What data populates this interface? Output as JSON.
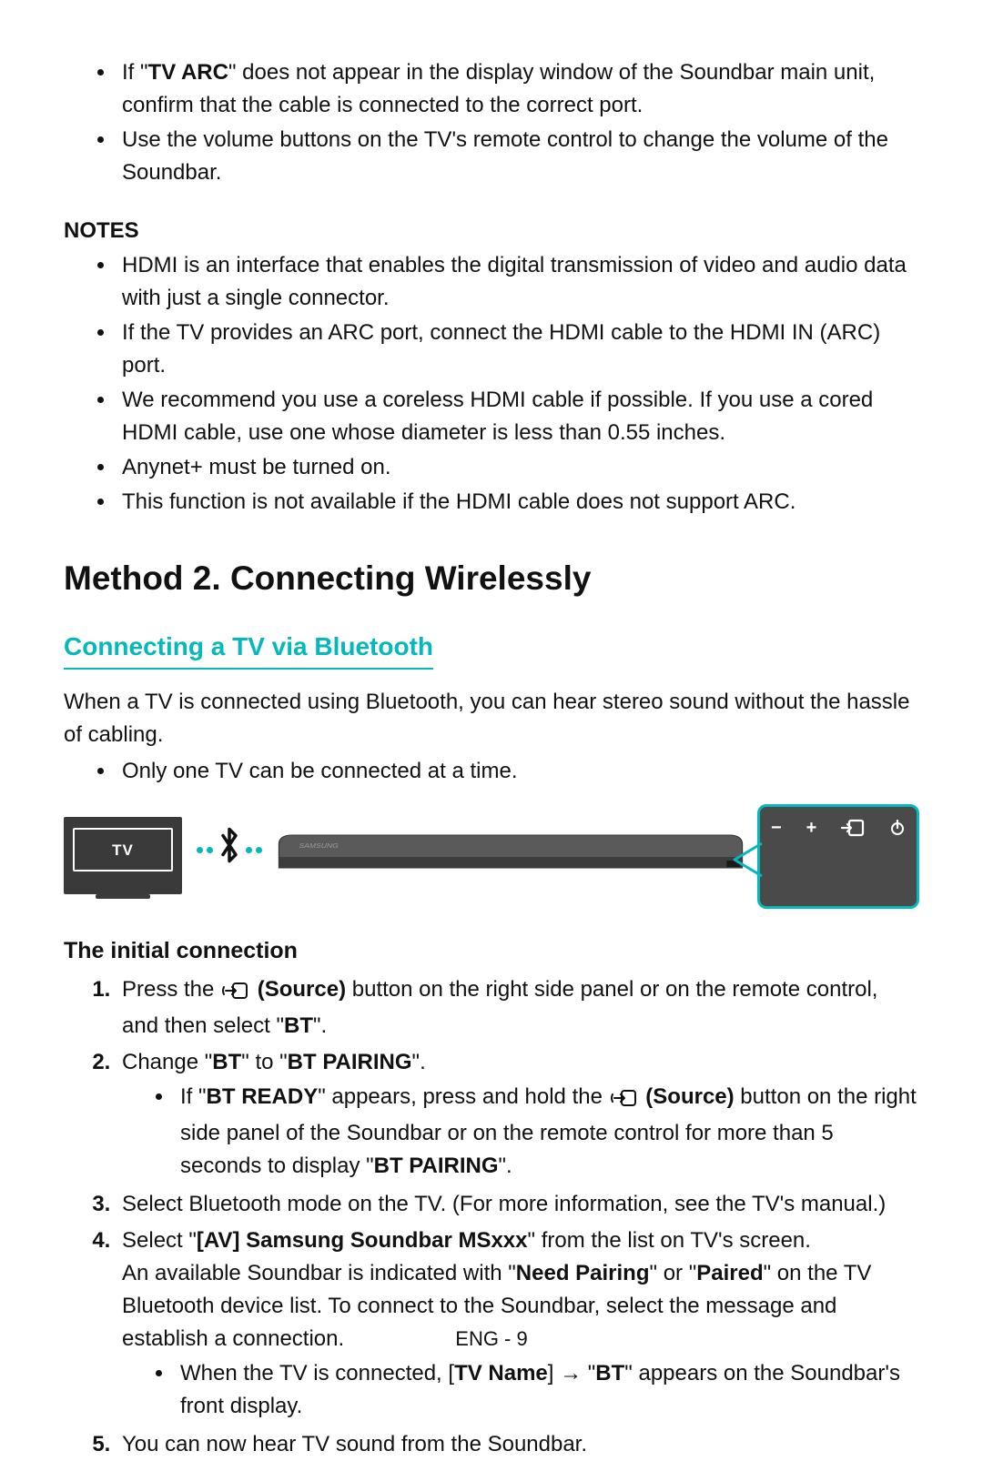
{
  "top_bullets": {
    "b1_pre": "If \"",
    "b1_bold": "TV ARC",
    "b1_post": "\" does not appear in the display window of the Soundbar main unit, confirm that the cable is connected to the correct port.",
    "b2": "Use the volume buttons on the TV's remote control to change the volume of the Soundbar."
  },
  "notes_heading": "NOTES",
  "notes": {
    "n1": "HDMI is an interface that enables the digital transmission of video and audio data with just a single connector.",
    "n2": "If the TV provides an ARC port, connect the HDMI cable to the HDMI IN (ARC) port.",
    "n3": "We recommend you use a coreless HDMI cable if possible. If you use a cored HDMI cable, use one whose diameter is less than 0.55 inches.",
    "n4": "Anynet+ must be turned on.",
    "n5": "This function is not available if the HDMI cable does not support ARC."
  },
  "method_heading": "Method 2. Connecting Wirelessly",
  "bluetooth_heading": "Connecting a TV via Bluetooth",
  "bluetooth_intro": "When a TV is connected using Bluetooth, you can hear stereo sound without the hassle of cabling.",
  "bluetooth_bullets": {
    "b1": "Only one TV can be connected at a time."
  },
  "diagram": {
    "tv_label": "TV",
    "panel_minus": "−",
    "panel_plus": "+"
  },
  "initial_heading": "The initial connection",
  "steps": {
    "s1_pre": "Press the ",
    "s1_source": "(Source)",
    "s1_mid": " button on the right side panel or on the remote control, and then select \"",
    "s1_bt": "BT",
    "s1_end": "\".",
    "s2_pre": "Change \"",
    "s2_bt": "BT",
    "s2_mid": "\" to \"",
    "s2_pair": "BT PAIRING",
    "s2_end": "\".",
    "s2_sub_pre": "If \"",
    "s2_sub_ready": "BT READY",
    "s2_sub_mid1": "\" appears, press and hold the ",
    "s2_sub_source": "(Source)",
    "s2_sub_mid2": " button on the right side panel of the Soundbar or on the remote control for more than 5 seconds to display \"",
    "s2_sub_pair": "BT PAIRING",
    "s2_sub_end": "\".",
    "s3": "Select Bluetooth mode on the TV. (For more information, see the TV's manual.)",
    "s4_pre": "Select \"",
    "s4_dev": "[AV] Samsung Soundbar MSxxx",
    "s4_post": "\" from the list on TV's screen.",
    "s4_line2_pre": "An available Soundbar is indicated with \"",
    "s4_need": "Need Pairing",
    "s4_line2_mid": "\" or \"",
    "s4_paired": "Paired",
    "s4_line2_post": "\" on the TV Bluetooth device list. To connect to the Soundbar, select the message and establish a connection.",
    "s4_sub_pre": "When the TV is connected, [",
    "s4_sub_tvname": "TV Name",
    "s4_sub_mid": "] → \"",
    "s4_sub_bt": "BT",
    "s4_sub_post": "\" appears on the Soundbar's front display.",
    "s5": "You can now hear TV sound from the Soundbar."
  },
  "page_number": "ENG - 9"
}
